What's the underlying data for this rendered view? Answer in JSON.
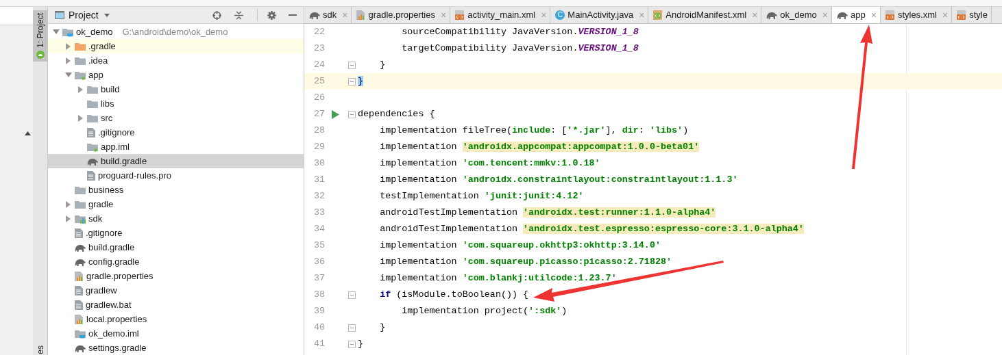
{
  "tool_window_strip": {
    "tabs": [
      {
        "label": "1: Project",
        "selected": true
      }
    ],
    "bottom_tab_fragment": "es"
  },
  "project_panel": {
    "title": "Project",
    "tree": [
      {
        "name": "ok_demo",
        "path": "G:\\android\\demo\\ok_demo",
        "kind": "project",
        "expanded": true,
        "selected": false,
        "highlighted": false,
        "children": [
          {
            "name": ".gradle",
            "kind": "excluded",
            "expanded": false,
            "selected": false,
            "highlighted": true
          },
          {
            "name": ".idea",
            "kind": "folder",
            "expanded": false,
            "selected": false,
            "highlighted": false
          },
          {
            "name": "app",
            "kind": "module",
            "expanded": true,
            "selected": false,
            "highlighted": false,
            "children": [
              {
                "name": "build",
                "kind": "folder",
                "expanded": false,
                "selected": false,
                "highlighted": false
              },
              {
                "name": "libs",
                "kind": "folder",
                "selected": false,
                "highlighted": false
              },
              {
                "name": "src",
                "kind": "folder",
                "expanded": false,
                "selected": false,
                "highlighted": false
              },
              {
                "name": ".gitignore",
                "kind": "text",
                "selected": false,
                "highlighted": false
              },
              {
                "name": "app.iml",
                "kind": "iml",
                "selected": false,
                "highlighted": false
              },
              {
                "name": "build.gradle",
                "kind": "gradle",
                "selected": true,
                "highlighted": false
              },
              {
                "name": "proguard-rules.pro",
                "kind": "text",
                "selected": false,
                "highlighted": false
              }
            ]
          },
          {
            "name": "business",
            "kind": "folder",
            "selected": false,
            "highlighted": false
          },
          {
            "name": "gradle",
            "kind": "folder",
            "expanded": false,
            "selected": false,
            "highlighted": false
          },
          {
            "name": "sdk",
            "kind": "library",
            "expanded": false,
            "selected": false,
            "highlighted": false
          },
          {
            "name": ".gitignore",
            "kind": "text",
            "selected": false,
            "highlighted": false
          },
          {
            "name": "build.gradle",
            "kind": "gradle",
            "selected": false,
            "highlighted": false
          },
          {
            "name": "config.gradle",
            "kind": "gradle",
            "selected": false,
            "highlighted": false
          },
          {
            "name": "gradle.properties",
            "kind": "properties",
            "selected": false,
            "highlighted": false
          },
          {
            "name": "gradlew",
            "kind": "text",
            "selected": false,
            "highlighted": false
          },
          {
            "name": "gradlew.bat",
            "kind": "text",
            "selected": false,
            "highlighted": false
          },
          {
            "name": "local.properties",
            "kind": "properties",
            "selected": false,
            "highlighted": false
          },
          {
            "name": "ok_demo.iml",
            "kind": "project",
            "selected": false,
            "highlighted": false
          },
          {
            "name": "settings.gradle",
            "kind": "gradle",
            "selected": false,
            "highlighted": false
          }
        ]
      }
    ]
  },
  "editor_tabs": [
    {
      "label": "sdk",
      "kind": "gradle",
      "selected": false,
      "closable": true
    },
    {
      "label": "gradle.properties",
      "kind": "properties",
      "selected": false,
      "closable": true
    },
    {
      "label": "activity_main.xml",
      "kind": "xml",
      "selected": false,
      "closable": true
    },
    {
      "label": "MainActivity.java",
      "kind": "class",
      "selected": false,
      "closable": true
    },
    {
      "label": "AndroidManifest.xml",
      "kind": "manifest",
      "selected": false,
      "closable": true
    },
    {
      "label": "ok_demo",
      "kind": "gradle",
      "selected": false,
      "closable": true
    },
    {
      "label": "app",
      "kind": "gradle",
      "selected": true,
      "closable": true
    },
    {
      "label": "styles.xml",
      "kind": "xml",
      "selected": false,
      "closable": true
    },
    {
      "label": "style",
      "kind": "xml",
      "selected": false,
      "closable": false
    }
  ],
  "class_icon_letter": "C",
  "tab_close_glyph": "×",
  "editor_lines": [
    {
      "number": "22",
      "current": false,
      "fold": false,
      "run": false,
      "segments": [
        {
          "text": "        sourceCompatibility JavaVersion.",
          "kind": "plain"
        },
        {
          "text": "VERSION_1_8",
          "kind": "constant"
        }
      ]
    },
    {
      "number": "23",
      "current": false,
      "fold": false,
      "run": false,
      "segments": [
        {
          "text": "        targetCompatibility JavaVersion.",
          "kind": "plain"
        },
        {
          "text": "VERSION_1_8",
          "kind": "constant"
        }
      ]
    },
    {
      "number": "24",
      "current": false,
      "fold": true,
      "run": false,
      "segments": [
        {
          "text": "    }",
          "kind": "plain"
        }
      ]
    },
    {
      "number": "25",
      "current": true,
      "fold": true,
      "run": false,
      "segments": [
        {
          "text": "}",
          "kind": "brace_match"
        }
      ]
    },
    {
      "number": "26",
      "current": false,
      "fold": false,
      "run": false
    },
    {
      "number": "27",
      "current": false,
      "fold": true,
      "run": true,
      "segments": [
        {
          "text": "dependencies {",
          "kind": "plain"
        }
      ]
    },
    {
      "number": "28",
      "current": false,
      "fold": false,
      "run": false,
      "segments": [
        {
          "text": "    implementation fileTree(",
          "kind": "plain"
        },
        {
          "text": "include",
          "kind": "string"
        },
        {
          "text": ": [",
          "kind": "plain"
        },
        {
          "text": "'*.jar'",
          "kind": "string"
        },
        {
          "text": "], ",
          "kind": "plain"
        },
        {
          "text": "dir",
          "kind": "string"
        },
        {
          "text": ": ",
          "kind": "plain"
        },
        {
          "text": "'libs'",
          "kind": "string"
        },
        {
          "text": ")",
          "kind": "plain"
        }
      ]
    },
    {
      "number": "29",
      "current": false,
      "fold": false,
      "run": false,
      "segments": [
        {
          "text": "    implementation ",
          "kind": "plain"
        },
        {
          "text": "'androidx.appcompat:appcompat:1.0.0-beta01'",
          "kind": "warning_string"
        }
      ]
    },
    {
      "number": "30",
      "current": false,
      "fold": false,
      "run": false,
      "segments": [
        {
          "text": "    implementation ",
          "kind": "plain"
        },
        {
          "text": "'com.tencent:mmkv:1.0.18'",
          "kind": "string"
        }
      ]
    },
    {
      "number": "31",
      "current": false,
      "fold": false,
      "run": false,
      "segments": [
        {
          "text": "    implementation ",
          "kind": "plain"
        },
        {
          "text": "'androidx.constraintlayout:constraintlayout:1.1.3'",
          "kind": "string"
        }
      ]
    },
    {
      "number": "32",
      "current": false,
      "fold": false,
      "run": false,
      "segments": [
        {
          "text": "    testImplementation ",
          "kind": "plain"
        },
        {
          "text": "'junit:junit:4.12'",
          "kind": "string"
        }
      ]
    },
    {
      "number": "33",
      "current": false,
      "fold": false,
      "run": false,
      "segments": [
        {
          "text": "    androidTestImplementation ",
          "kind": "plain"
        },
        {
          "text": "'androidx.test:runner:1.1.0-alpha4'",
          "kind": "warning_string"
        }
      ]
    },
    {
      "number": "34",
      "current": false,
      "fold": false,
      "run": false,
      "segments": [
        {
          "text": "    androidTestImplementation ",
          "kind": "plain"
        },
        {
          "text": "'androidx.test.espresso:espresso-core:3.1.0-alpha4'",
          "kind": "warning_string"
        }
      ]
    },
    {
      "number": "35",
      "current": false,
      "fold": false,
      "run": false,
      "segments": [
        {
          "text": "    implementation ",
          "kind": "plain"
        },
        {
          "text": "'com.squareup.okhttp3:okhttp:3.14.0'",
          "kind": "string"
        }
      ]
    },
    {
      "number": "36",
      "current": false,
      "fold": false,
      "run": false,
      "segments": [
        {
          "text": "    implementation ",
          "kind": "plain"
        },
        {
          "text": "'com.squareup.picasso:picasso:2.71828'",
          "kind": "string"
        }
      ]
    },
    {
      "number": "37",
      "current": false,
      "fold": false,
      "run": false,
      "segments": [
        {
          "text": "    implementation ",
          "kind": "plain"
        },
        {
          "text": "'com.blankj:utilcode:1.23.7'",
          "kind": "string"
        }
      ]
    },
    {
      "number": "38",
      "current": false,
      "fold": true,
      "run": false,
      "segments": [
        {
          "text": "    if",
          "kind": "keyword"
        },
        {
          "text": " (isModule.toBoolean()) {",
          "kind": "plain"
        }
      ]
    },
    {
      "number": "39",
      "current": false,
      "fold": false,
      "run": false,
      "segments": [
        {
          "text": "        implementation project(",
          "kind": "plain"
        },
        {
          "text": "':sdk'",
          "kind": "string"
        },
        {
          "text": ")",
          "kind": "plain"
        }
      ]
    },
    {
      "number": "40",
      "current": false,
      "fold": true,
      "run": false,
      "segments": [
        {
          "text": "    }",
          "kind": "plain"
        }
      ]
    },
    {
      "number": "41",
      "current": false,
      "fold": true,
      "run": false,
      "segments": [
        {
          "text": "}",
          "kind": "plain"
        }
      ]
    }
  ]
}
